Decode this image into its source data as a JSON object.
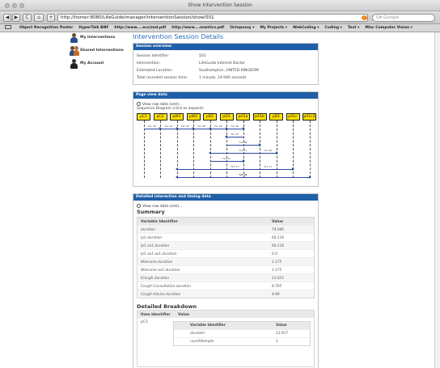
{
  "window": {
    "title": "Show Intervention Session"
  },
  "toolbar": {
    "back": "◀",
    "forward": "▶",
    "reload": "C",
    "add": "+",
    "url": "http://homer:8080/LifeGuide/manager/interventionSession/show/501",
    "search_placeholder": "Q▾ Google"
  },
  "bookmarks": [
    "Object Recognition Poster",
    "HyperTalk BNF",
    "http://www....ecs/zed.pdf",
    "http://www....mantics.pdf",
    "Octopussy ▾",
    "My Projects ▾",
    "WebCoding ▾",
    "Coding ▾",
    "Text ▾",
    "Misc Computer Vision ▾"
  ],
  "sidebar": {
    "items": [
      {
        "label": "My Interventions"
      },
      {
        "label": "Shared Interventions"
      },
      {
        "label": "My Account"
      }
    ]
  },
  "page": {
    "title": "Intervention Session Details"
  },
  "overview": {
    "heading": "Session overview",
    "rows": [
      {
        "key": "Session Identifier:",
        "value": "501"
      },
      {
        "key": "Intervention:",
        "value": "LifeGuide Internet Doctor"
      },
      {
        "key": "Estimated Location:",
        "value": "Southampton, UNITED KINGDOM"
      },
      {
        "key": "Total recorded session time:",
        "value": "1 minute, 14.946 seconds"
      }
    ]
  },
  "pageview": {
    "heading": "Page view data",
    "raw_link": "View raw data (xml)...",
    "caption": "Sequence Diagram (click to expand):",
    "nodes": [
      "pC1",
      "pC2",
      "pW1",
      "pW2",
      "pD2",
      "pD3",
      "pA1a",
      "pA1b",
      "pD1",
      "pA1c",
      "pA1c2"
    ],
    "messages": [
      {
        "from": 0,
        "to": 1,
        "row": 0,
        "label": "Tx1: 00"
      },
      {
        "from": 1,
        "to": 2,
        "row": 0,
        "label": "Tx1: 13"
      },
      {
        "from": 2,
        "to": 3,
        "row": 0,
        "label": "Tx1: 04"
      },
      {
        "from": 3,
        "to": 4,
        "row": 0,
        "label": "Tx1: 06"
      },
      {
        "from": 4,
        "to": 5,
        "row": 0,
        "label": "Tx1: 20"
      },
      {
        "from": 5,
        "to": 6,
        "row": 0,
        "label": "Tx1: 00"
      },
      {
        "from": 6,
        "to": 5,
        "row": 1,
        "label": "Tx1: 07"
      },
      {
        "from": 5,
        "to": 7,
        "row": 2,
        "label": "Tx1: 00"
      },
      {
        "from": 7,
        "to": 8,
        "row": 3,
        "label": "Tx1: 26"
      },
      {
        "from": 8,
        "to": 4,
        "row": 3,
        "label": "Tx1: 17"
      },
      {
        "from": 4,
        "to": 6,
        "row": 4,
        "label": "Tx1: 23"
      },
      {
        "from": 6,
        "to": 9,
        "row": 5,
        "label": "Tx1: 17"
      },
      {
        "from": 9,
        "to": 2,
        "row": 5,
        "label": "Tx1: 17"
      },
      {
        "from": 2,
        "to": 10,
        "row": 6,
        "label": "Tx1: 47"
      },
      {
        "from": 10,
        "to": 2,
        "row": 6,
        "label": "Tx1: 04"
      }
    ]
  },
  "detailed": {
    "heading": "Detailed interaction and timing data",
    "raw_link": "View raw data (xml)...",
    "summary_title": "Summary",
    "summary_headers": {
      "variable": "Variable Identifier",
      "value": "Value"
    },
    "summary_rows": [
      {
        "variable": "duration",
        "value": "74.946"
      },
      {
        "variable": "lp1.duration",
        "value": "60.116"
      },
      {
        "variable": "lp1-as1.duration",
        "value": "60.116"
      },
      {
        "variable": "lp1-as1-as1.duration",
        "value": "0.0"
      },
      {
        "variable": "Welcome.duration",
        "value": "1.175"
      },
      {
        "variable": "Welcome-as1.duration",
        "value": "1.175"
      },
      {
        "variable": "tCough.duration",
        "value": "13.655"
      },
      {
        "variable": "Cough-Consultation.duration",
        "value": "8.765"
      },
      {
        "variable": "Cough-Advice.duration",
        "value": "4.89"
      }
    ],
    "breakdown_title": "Detailed Breakdown",
    "breakdown_headers": {
      "item": "Item Identifier",
      "value": "Value"
    },
    "breakdown_item": "pC1",
    "breakdown_inner_headers": {
      "variable": "Variable Identifier",
      "value": "Value"
    },
    "breakdown_inner_rows": [
      {
        "variable": "duration",
        "value": "12.917"
      },
      {
        "variable": "numAttempts",
        "value": "1"
      }
    ]
  }
}
